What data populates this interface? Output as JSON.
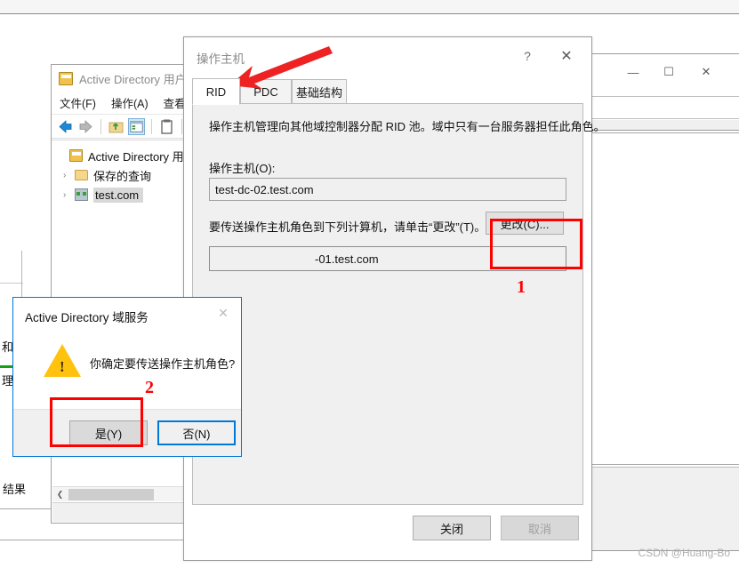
{
  "watermark": "CSDN @Huang-Bo",
  "aduc_window": {
    "title": "Active Directory 用户",
    "title_icon": "book-icon",
    "menu": [
      "文件(F)",
      "操作(A)",
      "查看"
    ],
    "toolbar_icons": [
      "back-arrow-icon",
      "forward-arrow-icon",
      "up-folder-icon",
      "show-tree-icon",
      "properties-icon"
    ],
    "tree": [
      {
        "label": "Active Directory 用户",
        "icon": "book-icon",
        "chevron": "",
        "selected": false,
        "indent": false
      },
      {
        "label": "保存的查询",
        "icon": "folder-icon",
        "chevron": "›",
        "selected": false,
        "indent": true
      },
      {
        "label": "test.com",
        "icon": "domain-icon",
        "chevron": "›",
        "selected": true,
        "indent": true
      }
    ]
  },
  "background_left": {
    "fragment_1": "和",
    "fragment_2": "理",
    "fragment_3": "结果"
  },
  "right_window": {
    "minimize_label": "—",
    "maximize_label": "☐",
    "close_label": "✕"
  },
  "operations_masters_dialog": {
    "title": "操作主机",
    "help_label": "?",
    "close_label": "✕",
    "tabs": [
      {
        "label": "RID",
        "active": true
      },
      {
        "label": "PDC",
        "active": false
      },
      {
        "label": "基础结构",
        "active": false
      }
    ],
    "description": "操作主机管理向其他域控制器分配 RID 池。域中只有一台服务器担任此角色。",
    "operations_master_label": "操作主机(O):",
    "operations_master_value": "test-dc-02.test.com",
    "transfer_instruction": "要传送操作主机角色到下列计算机，请单击“更改”(T)。",
    "change_button": "更改(C)...",
    "target_computer_value": "-01.test.com",
    "close_button": "关闭",
    "cancel_button": "取消"
  },
  "confirm_dialog": {
    "title": "Active Directory 域服务",
    "close_label": "✕",
    "icon": "warning-triangle-icon",
    "message": "你确定要传送操作主机角色?",
    "yes_button": "是(Y)",
    "no_button": "否(N)"
  },
  "annotations": {
    "marker_1": "1",
    "marker_2": "2",
    "arrow_color": "#ee2222",
    "box_color": "#ff0000"
  }
}
